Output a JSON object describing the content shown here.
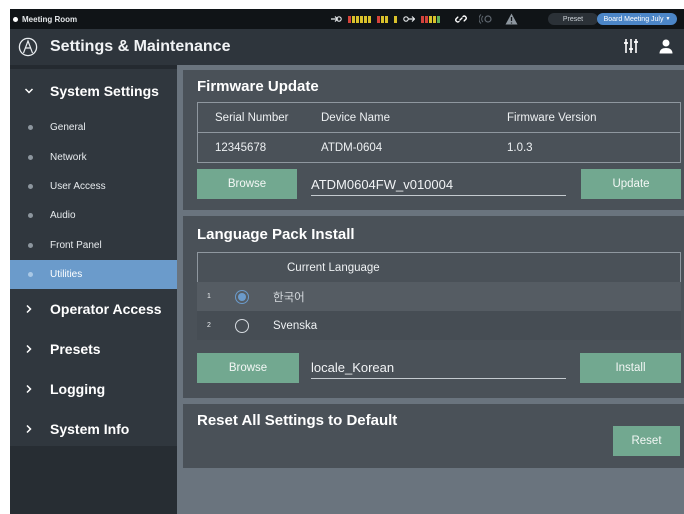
{
  "status": {
    "room_name": "Meeting Room",
    "preset_label": "Preset",
    "preset_value": "Board Meeting July"
  },
  "header": {
    "title": "Settings & Maintenance"
  },
  "sidebar": {
    "sections": [
      {
        "label": "System Settings",
        "expanded": true
      },
      {
        "label": "Operator Access",
        "expanded": false
      },
      {
        "label": "Presets",
        "expanded": false
      },
      {
        "label": "Logging",
        "expanded": false
      },
      {
        "label": "System Info",
        "expanded": false
      }
    ],
    "items": [
      {
        "label": "General"
      },
      {
        "label": "Network"
      },
      {
        "label": "User Access"
      },
      {
        "label": "Audio"
      },
      {
        "label": "Front Panel"
      },
      {
        "label": "Utilities",
        "active": true
      }
    ]
  },
  "firmware": {
    "title": "Firmware Update",
    "headers": [
      "Serial Number",
      "Device Name",
      "Firmware Version"
    ],
    "values": [
      "12345678",
      "ATDM-0604",
      "1.0.3"
    ],
    "browse_label": "Browse",
    "file_name": "ATDM0604FW_v010004",
    "update_label": "Update"
  },
  "language": {
    "title": "Language Pack Install",
    "header": "Current Language",
    "rows": [
      {
        "num": "1",
        "label": "한국어",
        "selected": true
      },
      {
        "num": "2",
        "label": "Svenska",
        "selected": false
      }
    ],
    "browse_label": "Browse",
    "file_name": "locale_Korean",
    "install_label": "Install"
  },
  "reset": {
    "title": "Reset All Settings to Default",
    "button_label": "Reset"
  },
  "colors": {
    "accent": "#6b9bcb",
    "button": "#72a890",
    "panel": "#4a5158",
    "sidebar": "#30373e"
  }
}
